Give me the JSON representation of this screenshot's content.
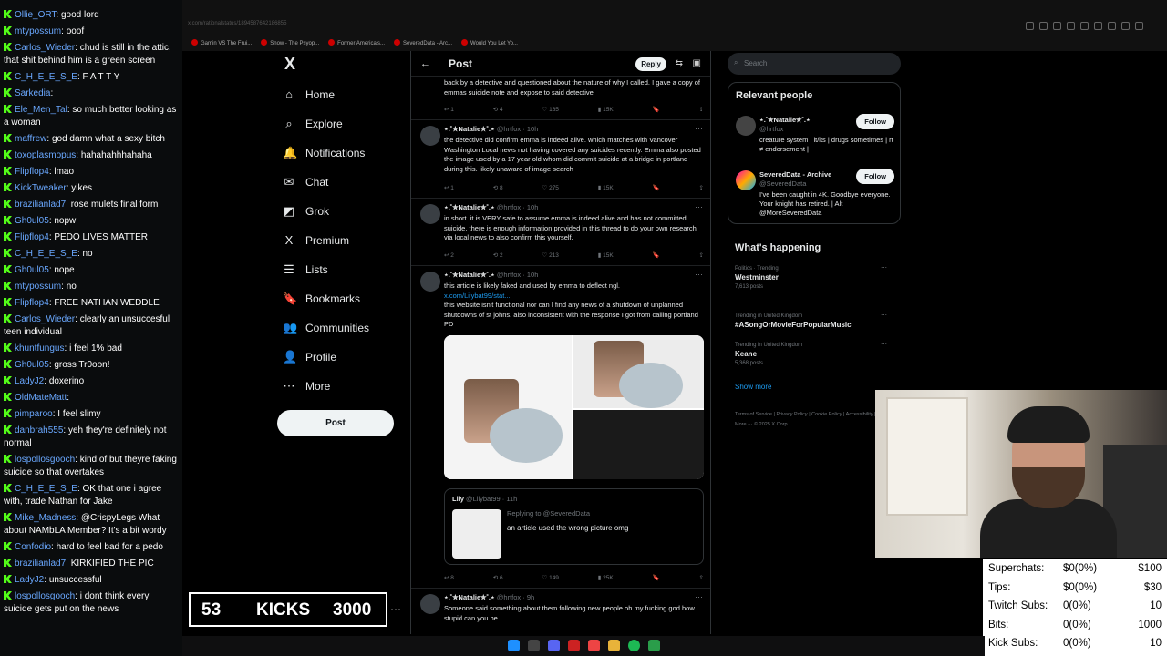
{
  "chat": [
    {
      "user": "Ollie_ORT",
      "text": "good lord"
    },
    {
      "user": "mtypossum",
      "text": "ooof"
    },
    {
      "user": "Carlos_Wieder",
      "text": "chud is still in the attic, that shit behind him is a green screen"
    },
    {
      "user": "C_H_E_E_S_E",
      "text": "F A T T Y"
    },
    {
      "user": "Sarkedia",
      "text": ""
    },
    {
      "user": "Ele_Men_Tal",
      "text": "so much better looking as a woman"
    },
    {
      "user": "maffrew",
      "text": "god damn what a sexy bitch"
    },
    {
      "user": "toxoplasmopus",
      "text": "hahahahhhahaha"
    },
    {
      "user": "Flipflop4",
      "text": "lmao"
    },
    {
      "user": "KickTweaker",
      "text": "yikes"
    },
    {
      "user": "brazilianlad7",
      "text": "rose mulets final form"
    },
    {
      "user": "Gh0ul05",
      "text": "nopw"
    },
    {
      "user": "Flipflop4",
      "text": "PEDO LIVES MATTER"
    },
    {
      "user": "C_H_E_E_S_E",
      "text": "no"
    },
    {
      "user": "Gh0ul05",
      "text": "nope"
    },
    {
      "user": "mtypossum",
      "text": "no"
    },
    {
      "user": "Flipflop4",
      "text": "FREE NATHAN WEDDLE"
    },
    {
      "user": "Carlos_Wieder",
      "text": "clearly an unsuccesful teen individual"
    },
    {
      "user": "khuntfungus",
      "text": "i feel 1% bad"
    },
    {
      "user": "Gh0ul05",
      "text": "gross Tr0oon!"
    },
    {
      "user": "LadyJ2",
      "text": "doxerino"
    },
    {
      "user": "OldMateMatt",
      "text": ""
    },
    {
      "user": "pimparoo",
      "text": "I feel slimy"
    },
    {
      "user": "danbrah555",
      "text": "yeh they're definitely not normal"
    },
    {
      "user": "lospollosgooch",
      "text": "kind of but theyre faking suicide so that overtakes"
    },
    {
      "user": "C_H_E_E_S_E",
      "text": "OK that one i agree with, trade Nathan for Jake"
    },
    {
      "user": "Mike_Madness",
      "text": "@CrispyLegs What about NAMbLA Member? It's a bit wordy"
    },
    {
      "user": "Confodio",
      "text": "hard to feel bad for a pedo"
    },
    {
      "user": "brazilianlad7",
      "text": "KIRKIFIED THE PIC"
    },
    {
      "user": "LadyJ2",
      "text": "unsuccessful"
    },
    {
      "user": "lospollosgooch",
      "text": "i dont think every suicide gets put on the news"
    }
  ],
  "browser": {
    "url": "x.com/rationalstatus/1894587642186855",
    "bookmarks": [
      "Gamin VS The Frui...",
      "Snow - The Psyop...",
      "Former America's...",
      "SeveredData - Arc...",
      "Would You Let Yo..."
    ]
  },
  "nav": {
    "logo": "X",
    "items": [
      {
        "label": "Home",
        "icon": "home-icon",
        "glyph": "⌂"
      },
      {
        "label": "Explore",
        "icon": "search-icon",
        "glyph": "⌕"
      },
      {
        "label": "Notifications",
        "icon": "bell-icon",
        "glyph": "🔔"
      },
      {
        "label": "Chat",
        "icon": "mail-icon",
        "glyph": "✉"
      },
      {
        "label": "Grok",
        "icon": "grok-icon",
        "glyph": "◩"
      },
      {
        "label": "Premium",
        "icon": "x-icon",
        "glyph": "X"
      },
      {
        "label": "Lists",
        "icon": "list-icon",
        "glyph": "☰"
      },
      {
        "label": "Bookmarks",
        "icon": "bookmark-icon",
        "glyph": "🔖"
      },
      {
        "label": "Communities",
        "icon": "people-icon",
        "glyph": "👥"
      },
      {
        "label": "Profile",
        "icon": "person-icon",
        "glyph": "👤"
      },
      {
        "label": "More",
        "icon": "more-icon",
        "glyph": "⋯"
      }
    ],
    "post_label": "Post"
  },
  "feed": {
    "title": "Post",
    "reply_label": "Reply",
    "tweets": [
      {
        "name": "",
        "handle": "",
        "time": "",
        "body": "back by a detective and questioned about the nature of why I called. I gave a copy of emmas suicide note and expose to said detective",
        "replies": "1",
        "reposts": "4",
        "likes": "165",
        "views": "15K"
      },
      {
        "name": "⋆.˚✮Natalie✮˚.⋆",
        "handle": "@hrtfox",
        "time": "10h",
        "body": "the detective did confirm emma is indeed alive. which matches with Vancover Washington Local news not having covered any suicides recently. Emma also posted the image used by a 17 year old whom did commit suicide at a bridge in portland during this. likely unaware of image search",
        "replies": "1",
        "reposts": "8",
        "likes": "275",
        "views": "15K"
      },
      {
        "name": "⋆.˚✮Natalie✮˚.⋆",
        "handle": "@hrtfox",
        "time": "10h",
        "body": "in short. it is VERY safe to assume emma is indeed alive and has not committed suicide. there is enough information provided in this thread to do your own research via local news to also confirm this yourself.",
        "replies": "2",
        "reposts": "2",
        "likes": "213",
        "views": "15K"
      },
      {
        "name": "⋆.˚✮Natalie✮˚.⋆",
        "handle": "@hrtfox",
        "time": "10h",
        "body": "this article is likely faked and used by emma to deflect ngl.",
        "link": "x.com/Lilybat99/stat...",
        "body2": "this website isn't functional nor can I find any news of a shutdown of unplanned shutdowns of st johns. also inconsistent with the response I got from calling portland PD",
        "quote_name": "Lily",
        "quote_handle": "@Lilybat99",
        "quote_time": "11h",
        "quote_reply": "Replying to @SeveredData",
        "quote_text": "an article used the wrong picture omg",
        "replies": "8",
        "reposts": "6",
        "likes": "149",
        "views": "25K"
      },
      {
        "name": "⋆.˚✮Natalie✮˚.⋆",
        "handle": "@hrtfox",
        "time": "9h",
        "body": "Someone said something about them following new people oh my fucking god how stupid can you be..",
        "replies": "",
        "reposts": "",
        "likes": "",
        "views": ""
      }
    ]
  },
  "right": {
    "search_placeholder": "Search",
    "relevant_title": "Relevant people",
    "people": [
      {
        "name": "⋆.˚✮Natalie✮˚.⋆",
        "handle": "@hrtfox",
        "bio": "creature system | lt/lts | drugs sometimes | rt ≠ endorsement |",
        "follow": "Follow"
      },
      {
        "name": "SeveredData - Archive",
        "handle": "@SeveredData",
        "bio": "I've been caught in 4K. Goodbye everyone. Your knight has retired. | Alt @MoreSeveredData",
        "follow": "Follow"
      }
    ],
    "happening_title": "What's happening",
    "trends": [
      {
        "ctx": "Politics · Trending",
        "name": "Westminster",
        "count": "7,613 posts"
      },
      {
        "ctx": "Trending in United Kingdom",
        "name": "#ASongOrMovieForPopularMusic",
        "count": ""
      },
      {
        "ctx": "Trending in United Kingdom",
        "name": "Keane",
        "count": "5,368 posts"
      }
    ],
    "show_more": "Show more",
    "footer": "Terms of Service | Privacy Policy | Cookie Policy | Accessibility | Ads info | More ··· © 2025 X Corp."
  },
  "kicks": {
    "count": "53",
    "label": "KICKS",
    "goal": "3000"
  },
  "stats": [
    {
      "label": "Superchats:",
      "value": "$0(0%)",
      "goal": "$100"
    },
    {
      "label": "Tips:",
      "value": "$0(0%)",
      "goal": "$30"
    },
    {
      "label": "Twitch Subs:",
      "value": "0(0%)",
      "goal": "10"
    },
    {
      "label": "Bits:",
      "value": "0(0%)",
      "goal": "1000"
    },
    {
      "label": "Kick Subs:",
      "value": "0(0%)",
      "goal": "10"
    }
  ]
}
